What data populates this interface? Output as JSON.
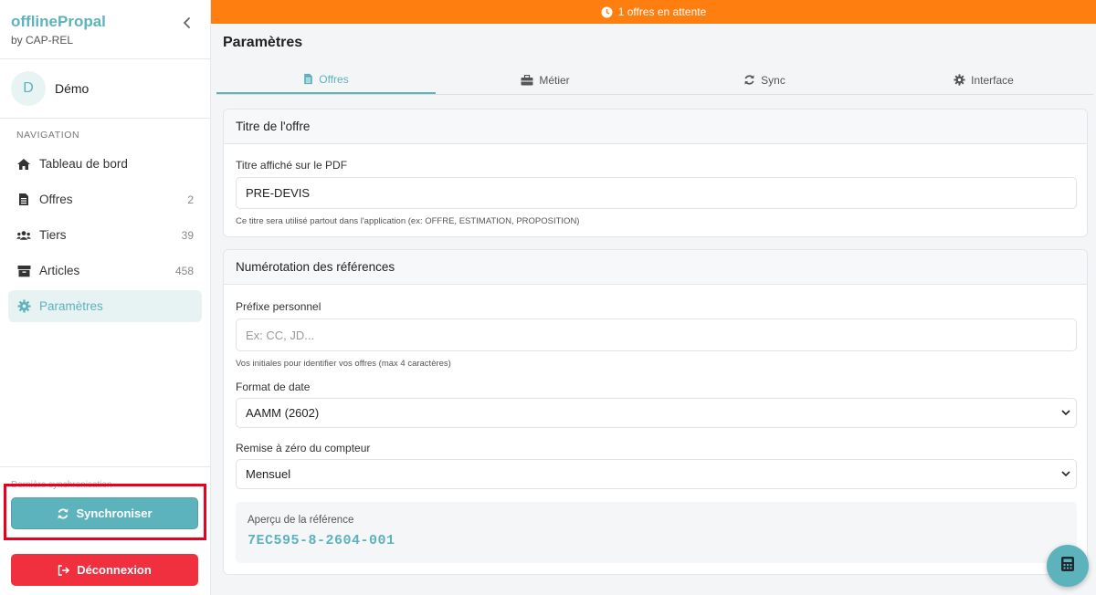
{
  "brand": {
    "title": "offlinePropal",
    "subtitle": "by CAP-REL"
  },
  "user": {
    "initial": "D",
    "name": "Démo"
  },
  "nav": {
    "label": "NAVIGATION",
    "items": [
      {
        "label": "Tableau de bord",
        "count": "",
        "icon": "home-icon"
      },
      {
        "label": "Offres",
        "count": "2",
        "icon": "file-icon"
      },
      {
        "label": "Tiers",
        "count": "39",
        "icon": "users-icon"
      },
      {
        "label": "Articles",
        "count": "458",
        "icon": "box-icon"
      },
      {
        "label": "Paramètres",
        "count": "",
        "icon": "gear-icon"
      }
    ]
  },
  "sidebar_bottom": {
    "last_sync": "Dernière synchronisation",
    "sync_label": "Synchroniser",
    "logout_label": "Déconnexion"
  },
  "banner": {
    "text": "1 offres en attente"
  },
  "page": {
    "title": "Paramètres",
    "tabs": [
      {
        "label": "Offres",
        "icon": "file-icon"
      },
      {
        "label": "Métier",
        "icon": "briefcase-icon"
      },
      {
        "label": "Sync",
        "icon": "sync-icon"
      },
      {
        "label": "Interface",
        "icon": "gear-icon"
      }
    ]
  },
  "offer_title_card": {
    "heading": "Titre de l'offre",
    "field_label": "Titre affiché sur le PDF",
    "value": "PRE-DEVIS",
    "help": "Ce titre sera utilisé partout dans l'application (ex: OFFRE, ESTIMATION, PROPOSITION)"
  },
  "numbering_card": {
    "heading": "Numérotation des références",
    "prefix_label": "Préfixe personnel",
    "prefix_value": "",
    "prefix_placeholder": "Ex: CC, JD...",
    "prefix_help": "Vos initiales pour identifier vos offres (max 4 caractères)",
    "date_format_label": "Format de date",
    "date_format_value": "AAMM (2602)",
    "reset_label": "Remise à zéro du compteur",
    "reset_value": "Mensuel",
    "preview_label": "Aperçu de la référence",
    "preview_value": "7EC595-8-2604-001"
  },
  "colors": {
    "accent": "#5db3bb",
    "banner": "#fe7f0f",
    "danger": "#f0303f",
    "highlight": "#e8001c"
  }
}
